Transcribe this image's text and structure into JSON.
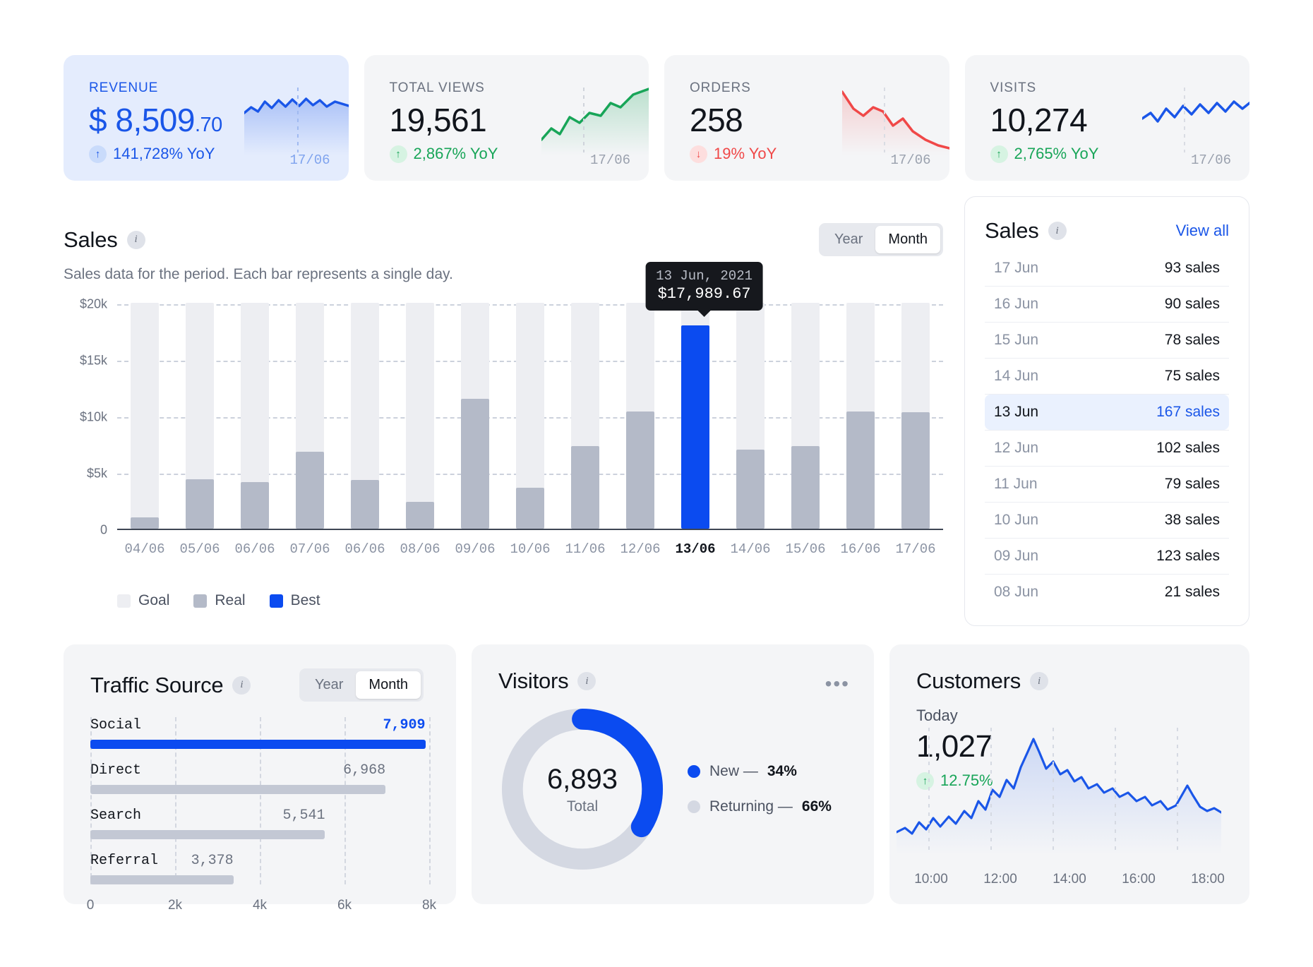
{
  "kpis": [
    {
      "label": "REVENUE",
      "value": "$ 8,509",
      "cents": ".70",
      "delta": "141,728% YoY",
      "dir": "up",
      "date": "17/06",
      "accent": true,
      "color": "#1a56e8"
    },
    {
      "label": "TOTAL VIEWS",
      "value": "19,561",
      "cents": "",
      "delta": "2,867% YoY",
      "dir": "up",
      "date": "17/06",
      "accent": false,
      "color": "#18a558"
    },
    {
      "label": "ORDERS",
      "value": "258",
      "cents": "",
      "delta": "19% YoY",
      "dir": "down",
      "date": "17/06",
      "accent": false,
      "color": "#f04848"
    },
    {
      "label": "VISITS",
      "value": "10,274",
      "cents": "",
      "delta": "2,765% YoY",
      "dir": "up",
      "date": "17/06",
      "accent": false,
      "color": "#1a56e8"
    }
  ],
  "sales": {
    "title": "Sales",
    "subtitle": "Sales data for the period. Each bar represents a single day.",
    "toggle": {
      "left": "Year",
      "right": "Month",
      "selected": "Month"
    },
    "legend": [
      {
        "label": "Goal",
        "color": "#edeef2"
      },
      {
        "label": "Real",
        "color": "#b4bac8"
      },
      {
        "label": "Best",
        "color": "#0b4bf0"
      }
    ],
    "tooltip": {
      "date": "13 Jun, 2021",
      "value": "$17,989.67"
    }
  },
  "chart_data": {
    "type": "bar",
    "title": "Sales",
    "xlabel": "",
    "ylabel": "",
    "ylim": [
      0,
      20000
    ],
    "yticks": [
      0,
      5000,
      10000,
      15000,
      20000
    ],
    "ytick_labels": [
      "0",
      "$5k",
      "$10k",
      "$15k",
      "$20k"
    ],
    "grid": true,
    "legend_position": "bottom-left",
    "categories": [
      "04/06",
      "05/06",
      "06/06",
      "07/06",
      "06/06",
      "08/06",
      "09/06",
      "10/06",
      "11/06",
      "12/06",
      "13/06",
      "14/06",
      "15/06",
      "16/06",
      "17/06"
    ],
    "highlight_index": 10,
    "series": [
      {
        "name": "Goal",
        "values": [
          20000,
          20000,
          20000,
          20000,
          20000,
          20000,
          20000,
          20000,
          20000,
          20000,
          20000,
          20000,
          20000,
          20000,
          20000
        ]
      },
      {
        "name": "Real",
        "values": [
          1000,
          4400,
          4100,
          6800,
          4300,
          2400,
          11500,
          3600,
          7300,
          10400,
          17989.67,
          7000,
          7300,
          10400,
          10300
        ]
      }
    ]
  },
  "sales_list": {
    "title": "Sales",
    "view_all": "View all",
    "rows": [
      {
        "date": "17 Jun",
        "value": "93 sales",
        "highlight": false
      },
      {
        "date": "16 Jun",
        "value": "90 sales",
        "highlight": false
      },
      {
        "date": "15 Jun",
        "value": "78 sales",
        "highlight": false
      },
      {
        "date": "14 Jun",
        "value": "75 sales",
        "highlight": false
      },
      {
        "date": "13 Jun",
        "value": "167 sales",
        "highlight": true
      },
      {
        "date": "12 Jun",
        "value": "102 sales",
        "highlight": false
      },
      {
        "date": "11 Jun",
        "value": "79 sales",
        "highlight": false
      },
      {
        "date": "10 Jun",
        "value": "38 sales",
        "highlight": false
      },
      {
        "date": "09 Jun",
        "value": "123 sales",
        "highlight": false
      },
      {
        "date": "08 Jun",
        "value": "21 sales",
        "highlight": false
      }
    ]
  },
  "traffic": {
    "title": "Traffic Source",
    "toggle": {
      "left": "Year",
      "right": "Month",
      "selected": "Month"
    },
    "axis_ticks": [
      "0",
      "2k",
      "4k",
      "6k",
      "8k"
    ],
    "max": 8000,
    "items": [
      {
        "name": "Social",
        "value": 7909,
        "label": "7,909",
        "top": true
      },
      {
        "name": "Direct",
        "value": 6968,
        "label": "6,968",
        "top": false
      },
      {
        "name": "Search",
        "value": 5541,
        "label": "5,541",
        "top": false
      },
      {
        "name": "Referral",
        "value": 3378,
        "label": "3,378",
        "top": false
      }
    ]
  },
  "visitors": {
    "title": "Visitors",
    "total": "6,893",
    "total_label": "Total",
    "menu": "•••",
    "segments": [
      {
        "name": "New",
        "label": "New — ",
        "pct_label": "34%",
        "pct": 34,
        "color": "#0b4bf0"
      },
      {
        "name": "Returning",
        "label": "Returning — ",
        "pct_label": "66%",
        "pct": 66,
        "color": "#d4d8e2"
      }
    ]
  },
  "customers": {
    "title": "Customers",
    "today_label": "Today",
    "value": "1,027",
    "delta": "12.75%",
    "dir": "up",
    "axis": [
      "10:00",
      "12:00",
      "14:00",
      "16:00",
      "18:00"
    ]
  }
}
